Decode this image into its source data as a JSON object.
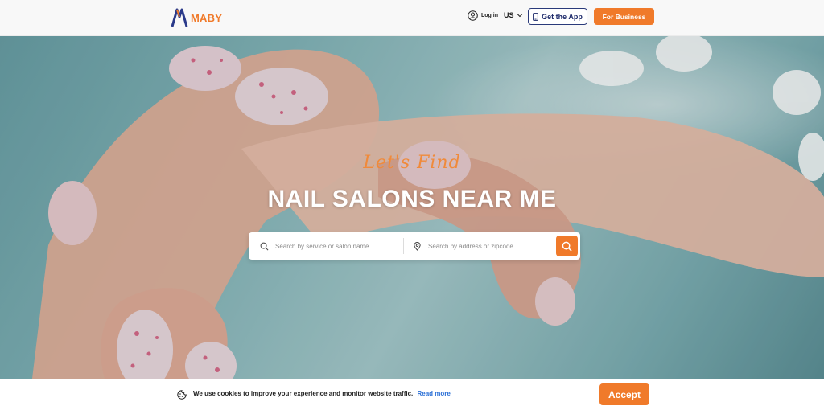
{
  "header": {
    "logo_text": "MABY",
    "login_label": "Log in",
    "language": "US",
    "get_app_label": "Get the App",
    "for_business_label": "For Business"
  },
  "hero": {
    "tagline": "Let's Find",
    "headline": "NAIL SALONS NEAR ME"
  },
  "search": {
    "service_placeholder": "Search by service or salon name",
    "location_placeholder": "Search by address or zipcode"
  },
  "cookie": {
    "message": "We use cookies to improve your experience and monitor website traffic.",
    "link_label": "Read more",
    "accept_label": "Accept"
  },
  "colors": {
    "brand_orange": "#f07a2a",
    "brand_navy": "#1d2a6a",
    "link_blue": "#2a6fd6"
  },
  "icons": [
    "user-icon",
    "chevron-down-icon",
    "phone-icon",
    "search-icon",
    "location-pin-icon",
    "cookie-icon"
  ]
}
